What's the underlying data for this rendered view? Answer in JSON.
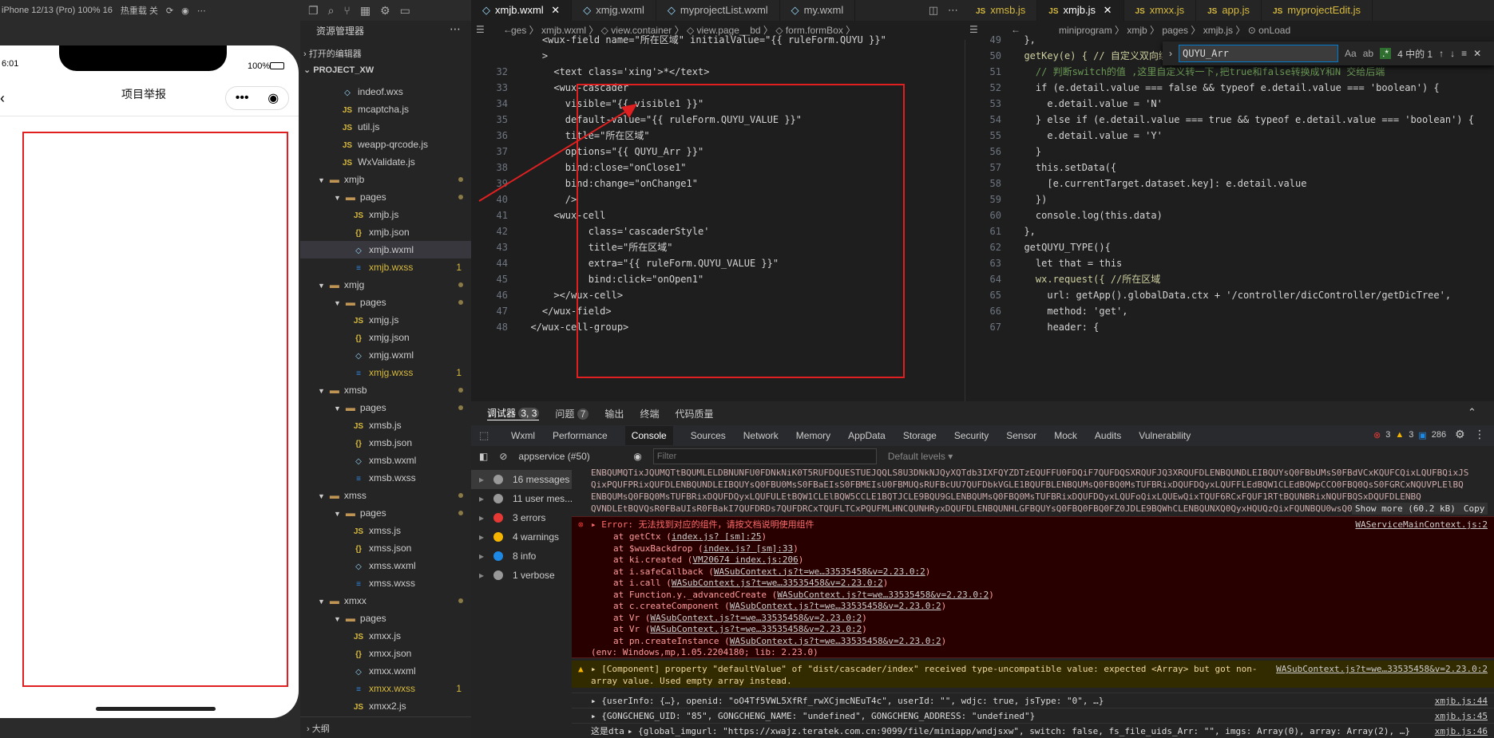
{
  "sim": {
    "device": "iPhone 12/13 (Pro) 100% 16",
    "hot": "热重载 关",
    "time": "6:01",
    "battery": "100%",
    "title": "项目举报",
    "capsule_dots": "•••"
  },
  "explorer": {
    "header": "资源管理器",
    "open_editors": "打开的编辑器",
    "project": "PROJECT_XW",
    "outline": "大纲",
    "files": [
      {
        "name": "indeof.wxs",
        "type": "wxml",
        "indent": 0
      },
      {
        "name": "mcaptcha.js",
        "type": "js",
        "indent": 0
      },
      {
        "name": "util.js",
        "type": "js",
        "indent": 0
      },
      {
        "name": "weapp-qrcode.js",
        "type": "js",
        "indent": 0
      },
      {
        "name": "WxValidate.js",
        "type": "js",
        "indent": 0
      },
      {
        "name": "xmjb",
        "type": "folder",
        "indent": -1
      },
      {
        "name": "pages",
        "type": "folder",
        "indent": 0
      },
      {
        "name": "xmjb.js",
        "type": "js",
        "indent": 1
      },
      {
        "name": "xmjb.json",
        "type": "json",
        "indent": 1
      },
      {
        "name": "xmjb.wxml",
        "type": "wxml",
        "indent": 1,
        "selected": true
      },
      {
        "name": "xmjb.wxss",
        "type": "wxss",
        "indent": 1,
        "badge": "1"
      },
      {
        "name": "xmjg",
        "type": "folder",
        "indent": -1
      },
      {
        "name": "pages",
        "type": "folder",
        "indent": 0
      },
      {
        "name": "xmjg.js",
        "type": "js",
        "indent": 1
      },
      {
        "name": "xmjg.json",
        "type": "json",
        "indent": 1
      },
      {
        "name": "xmjg.wxml",
        "type": "wxml",
        "indent": 1
      },
      {
        "name": "xmjg.wxss",
        "type": "wxss",
        "indent": 1,
        "badge": "1"
      },
      {
        "name": "xmsb",
        "type": "folder",
        "indent": -1
      },
      {
        "name": "pages",
        "type": "folder",
        "indent": 0
      },
      {
        "name": "xmsb.js",
        "type": "js",
        "indent": 1
      },
      {
        "name": "xmsb.json",
        "type": "json",
        "indent": 1
      },
      {
        "name": "xmsb.wxml",
        "type": "wxml",
        "indent": 1
      },
      {
        "name": "xmsb.wxss",
        "type": "wxss",
        "indent": 1
      },
      {
        "name": "xmss",
        "type": "folder",
        "indent": -1
      },
      {
        "name": "pages",
        "type": "folder",
        "indent": 0
      },
      {
        "name": "xmss.js",
        "type": "js",
        "indent": 1
      },
      {
        "name": "xmss.json",
        "type": "json",
        "indent": 1
      },
      {
        "name": "xmss.wxml",
        "type": "wxml",
        "indent": 1
      },
      {
        "name": "xmss.wxss",
        "type": "wxss",
        "indent": 1
      },
      {
        "name": "xmxx",
        "type": "folder",
        "indent": -1
      },
      {
        "name": "pages",
        "type": "folder",
        "indent": 0
      },
      {
        "name": "xmxx.js",
        "type": "js",
        "indent": 1
      },
      {
        "name": "xmxx.json",
        "type": "json",
        "indent": 1
      },
      {
        "name": "xmxx.wxml",
        "type": "wxml",
        "indent": 1
      },
      {
        "name": "xmxx.wxss",
        "type": "wxss",
        "indent": 1,
        "badge": "1"
      },
      {
        "name": "xmxx2.js",
        "type": "js",
        "indent": 1
      }
    ]
  },
  "tabs_left": [
    "xmjb.wxml",
    "xmjg.wxml",
    "myprojectList.wxml",
    "my.wxml"
  ],
  "tabs_right": [
    "xmsb.js",
    "xmjb.js",
    "xmxx.js",
    "app.js",
    "myprojectEdit.js"
  ],
  "crumb_left": "ges  〉 xmjb.wxml 〉 ◇ view.container 〉 ◇ view.page__bd 〉 ◇ form.formBox 〉",
  "crumb_right": "miniprogram 〉 xmjb 〉 pages 〉 xmjb.js 〉 ⊙ onLoad",
  "find": {
    "value": "QUYU_Arr",
    "count": "4 中的 1"
  },
  "code_left": [
    {
      "n": "",
      "html": "    <wux-field name=\"所在区域\" initialValue=\"{{ ruleForm.QUYU }}\""
    },
    {
      "n": "",
      "html": "    >"
    },
    {
      "n": "32",
      "html": "      <text class='xing'>*</text>"
    },
    {
      "n": "33",
      "html": "      <wux-cascader"
    },
    {
      "n": "34",
      "html": "        visible=\"{{ visible1 }}\""
    },
    {
      "n": "35",
      "html": "        default-value=\"{{ ruleForm.QUYU_VALUE }}\""
    },
    {
      "n": "36",
      "html": "        title=\"所在区域\""
    },
    {
      "n": "37",
      "html": "        options=\"{{ QUYU_Arr }}\""
    },
    {
      "n": "38",
      "html": "        bind:close=\"onClose1\""
    },
    {
      "n": "39",
      "html": "        bind:change=\"onChange1\""
    },
    {
      "n": "40",
      "html": "        />"
    },
    {
      "n": "41",
      "html": "      <wux-cell"
    },
    {
      "n": "42",
      "html": "            class='cascaderStyle'"
    },
    {
      "n": "43",
      "html": "            title=\"所在区域\""
    },
    {
      "n": "44",
      "html": "            extra=\"{{ ruleForm.QUYU_VALUE }}\""
    },
    {
      "n": "45",
      "html": "            bind:click=\"onOpen1\""
    },
    {
      "n": "46",
      "html": "      ></wux-cell>"
    },
    {
      "n": "47",
      "html": "    </wux-field>"
    },
    {
      "n": "48",
      "html": "  </wux-cell-group>"
    }
  ],
  "code_right": [
    {
      "n": "49",
      "t": "  },"
    },
    {
      "n": "50",
      "t": "  getKey(e) { // 自定义双向绑定"
    },
    {
      "n": "51",
      "t": "    // 判断switch的值 ,这里自定义转一下,把true和false转换成Y和N 交给后端"
    },
    {
      "n": "52",
      "t": "    if (e.detail.value === false && typeof e.detail.value === 'boolean') {"
    },
    {
      "n": "53",
      "t": "      e.detail.value = 'N'"
    },
    {
      "n": "54",
      "t": "    } else if (e.detail.value === true && typeof e.detail.value === 'boolean') {"
    },
    {
      "n": "55",
      "t": "      e.detail.value = 'Y'"
    },
    {
      "n": "56",
      "t": "    }"
    },
    {
      "n": "57",
      "t": "    this.setData({"
    },
    {
      "n": "58",
      "t": "      [e.currentTarget.dataset.key]: e.detail.value"
    },
    {
      "n": "59",
      "t": "    })"
    },
    {
      "n": "60",
      "t": "    console.log(this.data)"
    },
    {
      "n": "61",
      "t": "  },"
    },
    {
      "n": "62",
      "t": "  getQUYU_TYPE(){"
    },
    {
      "n": "63",
      "t": "    let that = this"
    },
    {
      "n": "64",
      "t": "    wx.request({ //所在区域"
    },
    {
      "n": "65",
      "t": "      url: getApp().globalData.ctx + '/controller/dicController/getDicTree',"
    },
    {
      "n": "66",
      "t": "      method: 'get',"
    },
    {
      "n": "67",
      "t": "      header: {"
    }
  ],
  "panel_tabs": [
    "调试器",
    "3, 3",
    "问题",
    "7",
    "输出",
    "终端",
    "代码质量"
  ],
  "dev_tabs": [
    "Wxml",
    "Performance",
    "Console",
    "Sources",
    "Network",
    "Memory",
    "AppData",
    "Storage",
    "Security",
    "Sensor",
    "Mock",
    "Audits",
    "Vulnerability"
  ],
  "dev_counts": {
    "err": "3",
    "warn": "3",
    "info": "286"
  },
  "toolbar": {
    "context": "appservice (#50)",
    "filter": "Filter",
    "levels": "Default levels ▾"
  },
  "console_side": [
    {
      "label": "16 messages",
      "c": "#999"
    },
    {
      "label": "11 user mes...",
      "c": "#999"
    },
    {
      "label": "3 errors",
      "c": "#e53935"
    },
    {
      "label": "4 warnings",
      "c": "#f5b400"
    },
    {
      "label": "8 info",
      "c": "#1e88e5"
    },
    {
      "label": "1 verbose",
      "c": "#999"
    }
  ],
  "console": {
    "b64_1": "ENBQUMQTixJQUMQTtBQUMLELDBNUNFU0FDNkNiK0T5RUFDQUESTUEJQQLS8U3DNkNJQyXQTdb3IXFQYZDTzEQUFFU0FDQiF7QUFDQSXRQUFJQ3XRQUFDLENBQUNDLEIBQUYsQ0FBbUMsS0FBdVCxKQUFCQixLQUFBQixJS",
    "b64_2": "QixPQUFPRixQUFDLENBQUNDLEIBQUYsQ0FBU0MsS0FBaEIsS0FBMEIsU0FBMUQsRUFBcUU7QUFDbkVGLE1BQUFBLENBQUMsQ0FBQ0MsTUFBRixDQUFDQyxLQUFFLEdBQW1CLEdBQWpCCO0FBQ0QsS0FGRCxNQUVPLElBQ",
    "b64_3": "ENBQUMsQ0FBQ0MsTUFBRixDQUFDQyxLQUFULEtBQW1CLElBQW5CCLE1BQTJCLE9BQU9GLENBQUMsQ0FBQ0MsTUFBRixDQUFDQyxLQUFoQixLQUEwQixTQUF6RCxFQUF1RTtBQUNBRixNQUFBQSxDQUFDLENBQ",
    "b64_4": "QVNDLEtBQVQsR0FBaUIsR0FBakI7QUFDRDs7QUFDRCxTQUFLTCxPQUFMLHNCQUNHRyxDQUFDLENBQUNHLGFBQUYsQ0FBQ0FBQ0FZ0JDLE9BQWhCLENBQUNXQ0QyxHQUQzQixFQUNBQU0wsQ0FBQyxDQUF",
    "show_more": "Show more (60.2 kB)",
    "copy": "Copy",
    "error_title": "▸ Error: 无法找到对应的组件，请按文档说明使用组件",
    "error_src": "WAServiceMainContext.js:2",
    "stack": [
      {
        "pre": "at getCtx (",
        "link": "index.js? [sm]:25",
        "post": ")"
      },
      {
        "pre": "at $wuxBackdrop (",
        "link": "index.js? [sm]:33",
        "post": ")"
      },
      {
        "pre": "at ki.created (",
        "link": "VM20674 index.js:206",
        "post": ")"
      },
      {
        "pre": "at i.safeCallback (",
        "link": "WASubContext.js?t=we…33535458&v=2.23.0:2",
        "post": ")"
      },
      {
        "pre": "at i.call (",
        "link": "WASubContext.js?t=we…33535458&v=2.23.0:2",
        "post": ")"
      },
      {
        "pre": "at Function.y._advancedCreate (",
        "link": "WASubContext.js?t=we…33535458&v=2.23.0:2",
        "post": ")"
      },
      {
        "pre": "at c.createComponent (",
        "link": "WASubContext.js?t=we…33535458&v=2.23.0:2",
        "post": ")"
      },
      {
        "pre": "at Vr (",
        "link": "WASubContext.js?t=we…33535458&v=2.23.0:2",
        "post": ")"
      },
      {
        "pre": "at Vr (",
        "link": "WASubContext.js?t=we…33535458&v=2.23.0:2",
        "post": ")"
      },
      {
        "pre": "at pn.createInstance (",
        "link": "WASubContext.js?t=we…33535458&v=2.23.0:2",
        "post": ")"
      }
    ],
    "env": "(env: Windows,mp,1.05.2204180; lib: 2.23.0)",
    "warn_1": "▸ [Component] property \"defaultValue\" of \"dist/cascader/index\" received type-uncompatible value: expected <Array> but got non-",
    "warn_2": "array value. Used empty array instead.",
    "warn_src": "WASubContext.js?t=we…33535458&v=2.23.0:2",
    "log1": "▸ {userInfo: {…}, openid: \"oO4Tf5VWL5XfRf_rwXCjmcNEuT4c\", userId: \"\", wdjc: true, jsType: \"0\", …}",
    "log1_src": "xmjb.js:44",
    "log2": "▸ {GONGCHENG_UID: \"85\", GONGCHENG_NAME: \"undefined\", GONGCHENG_ADDRESS: \"undefined\"}",
    "log2_src": "xmjb.js:45",
    "log3_pre": "这是dta",
    "log3": "▸ {global_imgurl: \"https://xwajz.teratek.com.cn:9099/file/miniapp/wndjsxw\", switch: false, fs_file_uids_Arr: \"\", imgs: Array(0), array: Array(2), …}",
    "log3_src": "xmjb.js:46"
  },
  "colors": {
    "accent": "#007acc",
    "error": "#e53935",
    "warn": "#f5b400",
    "redbox": "#e02020"
  }
}
